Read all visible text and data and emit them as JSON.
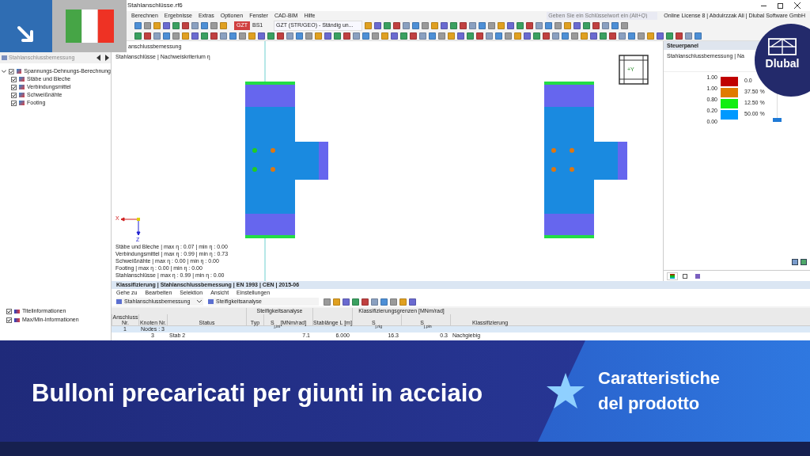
{
  "window": {
    "title": "Stahlanschlüsse.rf6",
    "search_placeholder": "Geben Sie ein Schlüsselwort ein (Alt+Q)",
    "license": "Online License 8 | Abdulrzzak Ali | Dlubal Software GmbH"
  },
  "menu": [
    "Berechnen",
    "Ergebnisse",
    "Extras",
    "Optionen",
    "Fenster",
    "CAD-BIM",
    "Hilfe"
  ],
  "toolbar": {
    "badge": "GZT",
    "combo_id": "BS1",
    "combo": "GZT (STR/GEO) - Ständig un..."
  },
  "navigator": {
    "dropdown": "Stahlanschlussbemessung",
    "tree": [
      {
        "label": "Spannungs-Dehnungs-Berechnung",
        "checked": true,
        "expanded": true,
        "children": [
          {
            "label": "Stäbe und Bleche",
            "checked": true
          },
          {
            "label": "Verbindungsmittel",
            "checked": true
          },
          {
            "label": "Schweißnähte",
            "checked": true
          },
          {
            "label": "Footing",
            "checked": true
          }
        ]
      }
    ],
    "bottom_items": [
      {
        "label": "Titelinformationen",
        "checked": true
      },
      {
        "label": "Max/Min-Informationen",
        "checked": true
      }
    ]
  },
  "viewport": {
    "title_lines": [
      "anschlussbemessung",
      "Stahlanschlüsse | Nachweiskriterium η"
    ],
    "axis_x": "X",
    "axis_z": "Z",
    "nav_cube": "+Y",
    "results": [
      "Stäbe und Bleche | max η : 0.07 | min η : 0.00",
      "Verbindungsmittel | max η : 0.99 | min η : 0.73",
      "Schweißnähte | max η : 0.00 | min η : 0.00",
      "Footing | max η : 0.00 | min η : 0.00",
      "Stahlanschlüsse | max η : 0.99 | min η : 0.00"
    ],
    "joints": [
      {
        "bolts": [
          {
            "color": "#22cc22"
          },
          {
            "color": "#dd7711"
          },
          {
            "color": "#22cc22"
          },
          {
            "color": "#dd7711"
          }
        ]
      },
      {
        "bolts": [
          {
            "color": "#dd7711"
          },
          {
            "color": "#dd7711"
          },
          {
            "color": "#dd7711"
          },
          {
            "color": "#dd7711"
          }
        ]
      }
    ]
  },
  "control_panel": {
    "title": "Steuerpanel",
    "subtitle": "Stahlanschlussbemessung | Na",
    "scale": [
      "1.00",
      "1.00",
      "0.80",
      "0.20",
      "0.00"
    ],
    "bands": [
      {
        "color": "#c00000",
        "percent": "0.0"
      },
      {
        "color": "#e07b00",
        "percent": "37.50 %"
      },
      {
        "color": "#11ee11",
        "percent": "12.50 %"
      },
      {
        "color": "#0099ff",
        "percent": "50.00 %"
      }
    ],
    "tabs": [
      {
        "selected": true
      },
      {
        "selected": false
      },
      {
        "selected": false
      }
    ]
  },
  "table_panel": {
    "title": "Klassifizierung | Stahlanschlussbemessung | EN 1993 | CEN | 2015-06",
    "menu": [
      "Gehe zu",
      "Bearbeiten",
      "Selektion",
      "Ansicht",
      "Einstellungen"
    ],
    "module": "Stahlanschlussbemessung",
    "analysis": "Steifigkeitsanalyse",
    "group_headers": [
      "Steifigkeitsanalyse",
      "Klassifizierungsgrenzen [MNm/rad]"
    ],
    "columns": [
      "Anschluss Nr.",
      "Knoten Nr.",
      "Status",
      "Typ",
      "S$_{j,ini}$ [MNm/rad]",
      "Stablänge L [m]",
      "S$_{j,rig}$",
      "S$_{j,pin}$",
      "Klassifizierung"
    ],
    "group_row": {
      "number": "1",
      "label": "Nodes : 3"
    },
    "rows": [
      [
        "",
        "3",
        "Stab 2",
        "",
        "7.1",
        "6.000",
        "16.3",
        "0.3",
        "Nachgiebig"
      ]
    ]
  },
  "banner": {
    "title": "Bulloni precaricati per giunti in acciaio",
    "tag": "Caratteristiche del prodotto"
  },
  "logo": {
    "text": "Dlubal"
  }
}
